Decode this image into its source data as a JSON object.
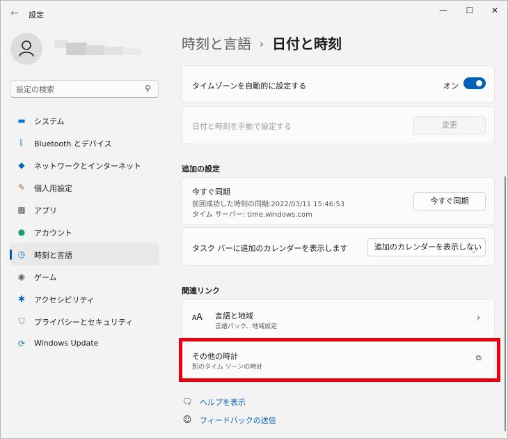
{
  "window": {
    "app_title": "設定",
    "controls": {
      "minimize": "—",
      "maximize": "☐",
      "close": "✕"
    },
    "back": "←"
  },
  "sidebar": {
    "search_placeholder": "設定の検索",
    "items": [
      {
        "label": "システム",
        "icon": "monitor-icon",
        "glyph": "▬",
        "color": "#0078d4"
      },
      {
        "label": "Bluetooth とデバイス",
        "icon": "bluetooth-icon",
        "glyph": "ᛒ",
        "color": "#0078d4"
      },
      {
        "label": "ネットワークとインターネット",
        "icon": "wifi-icon",
        "glyph": "◆",
        "color": "#0067c0"
      },
      {
        "label": "個人用設定",
        "icon": "brush-icon",
        "glyph": "✎",
        "color": "#b26b2f"
      },
      {
        "label": "アプリ",
        "icon": "apps-icon",
        "glyph": "▦",
        "color": "#555555"
      },
      {
        "label": "アカウント",
        "icon": "account-icon",
        "glyph": "●",
        "color": "#1e9c6e"
      },
      {
        "label": "時刻と言語",
        "icon": "clock-globe-icon",
        "glyph": "◷",
        "color": "#0078d4",
        "active": true
      },
      {
        "label": "ゲーム",
        "icon": "gamepad-icon",
        "glyph": "◉",
        "color": "#666666"
      },
      {
        "label": "アクセシビリティ",
        "icon": "accessibility-icon",
        "glyph": "✱",
        "color": "#0067c0"
      },
      {
        "label": "プライバシーとセキュリティ",
        "icon": "shield-icon",
        "glyph": "⛉",
        "color": "#666666"
      },
      {
        "label": "Windows Update",
        "icon": "update-icon",
        "glyph": "⟳",
        "color": "#0078d4"
      }
    ]
  },
  "header": {
    "parent": "時刻と言語",
    "separator": "›",
    "current": "日付と時刻"
  },
  "main": {
    "auto_timezone": {
      "label": "タイムゾーンを自動的に設定する",
      "state": "オン",
      "on": true
    },
    "manual_time": {
      "label": "日付と時刻を手動で設定する",
      "button": "変更"
    },
    "additional_title": "追加の設定",
    "sync": {
      "title": "今すぐ同期",
      "last_sync": "前回成功した時刻の同期:2022/03/11 15:46:53",
      "server": "タイム サーバー: time.windows.com",
      "button": "今すぐ同期"
    },
    "calendar": {
      "label": "タスク バーに追加のカレンダーを表示します",
      "selected": "追加のカレンダーを表示しない"
    },
    "related_title": "関連リンク",
    "language_region": {
      "title": "言語と地域",
      "subtitle": "言語パック、地域設定"
    },
    "other_clocks": {
      "title": "その他の時計",
      "subtitle": "別のタイム ゾーンの時計"
    },
    "help": "ヘルプを表示",
    "feedback": "フィードバックの送信"
  },
  "colors": {
    "accent": "#005fb8",
    "highlight": "#e60012"
  }
}
